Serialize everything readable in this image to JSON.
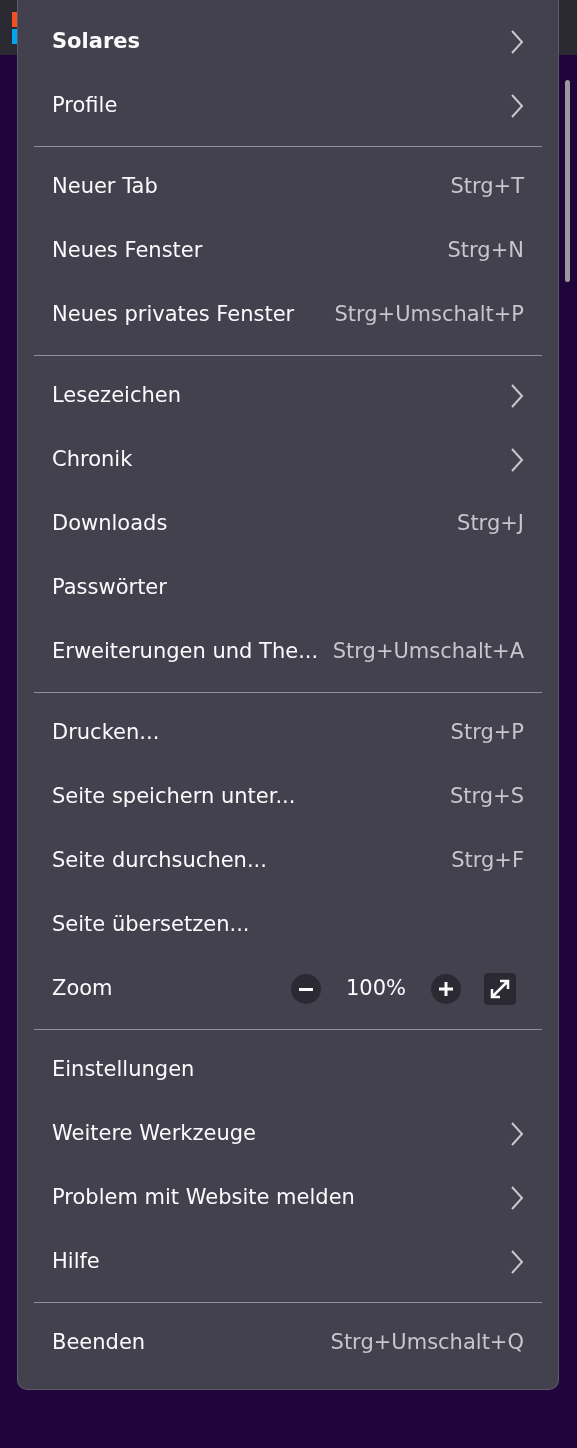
{
  "menu": {
    "sections": [
      {
        "items": [
          {
            "kind": "account",
            "label": "Solares"
          },
          {
            "kind": "submenu",
            "label": "Profile"
          }
        ]
      },
      {
        "items": [
          {
            "kind": "shortcut",
            "label": "Neuer Tab",
            "shortcut": "Strg+T"
          },
          {
            "kind": "shortcut",
            "label": "Neues Fenster",
            "shortcut": "Strg+N"
          },
          {
            "kind": "shortcut",
            "label": "Neues privates Fenster",
            "shortcut": "Strg+Umschalt+P"
          }
        ]
      },
      {
        "items": [
          {
            "kind": "submenu",
            "label": "Lesezeichen"
          },
          {
            "kind": "submenu",
            "label": "Chronik"
          },
          {
            "kind": "shortcut",
            "label": "Downloads",
            "shortcut": "Strg+J"
          },
          {
            "kind": "plain",
            "label": "Passwörter"
          },
          {
            "kind": "shortcut",
            "label": "Erweiterungen und The...",
            "shortcut": "Strg+Umschalt+A"
          }
        ]
      },
      {
        "items": [
          {
            "kind": "shortcut",
            "label": "Drucken...",
            "shortcut": "Strg+P"
          },
          {
            "kind": "shortcut",
            "label": "Seite speichern unter...",
            "shortcut": "Strg+S"
          },
          {
            "kind": "shortcut",
            "label": "Seite durchsuchen...",
            "shortcut": "Strg+F"
          },
          {
            "kind": "plain",
            "label": "Seite übersetzen..."
          },
          {
            "kind": "zoom",
            "label": "Zoom",
            "value": "100%"
          }
        ]
      },
      {
        "items": [
          {
            "kind": "plain",
            "label": "Einstellungen"
          },
          {
            "kind": "submenu",
            "label": "Weitere Werkzeuge"
          },
          {
            "kind": "submenu",
            "label": "Problem mit Website melden"
          },
          {
            "kind": "submenu",
            "label": "Hilfe"
          }
        ]
      },
      {
        "items": [
          {
            "kind": "shortcut",
            "label": "Beenden",
            "shortcut": "Strg+Umschalt+Q"
          }
        ]
      }
    ]
  }
}
